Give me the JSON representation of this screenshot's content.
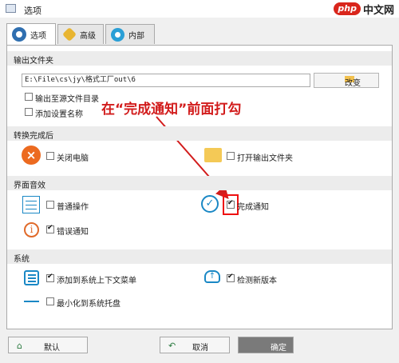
{
  "window": {
    "title": "选项"
  },
  "watermark": {
    "php": "php",
    "text": "中文网"
  },
  "tabs": [
    {
      "label": "选项",
      "icon": "gear-icon"
    },
    {
      "label": "高级",
      "icon": "advanced-icon"
    },
    {
      "label": "内部",
      "icon": "gear-icon"
    }
  ],
  "output_folder": {
    "heading": "输出文件夹",
    "path_value": "E:\\File\\cs\\jy\\格式工厂out\\6",
    "change_label": "改变",
    "options": [
      {
        "label": "输出至源文件目录",
        "checked": false
      },
      {
        "label": "添加设置名称",
        "checked": false
      }
    ]
  },
  "annotation": {
    "text": "在“完成通知”前面打勾",
    "color": "#d21c1c"
  },
  "after_convert": {
    "heading": "转换完成后",
    "shutdown": {
      "label": "关闭电脑",
      "checked": false,
      "icon": "close-circle-icon"
    },
    "open_folder": {
      "label": "打开输出文件夹",
      "checked": false,
      "icon": "folder-icon"
    }
  },
  "ui_sound": {
    "heading": "界面音效",
    "normal_action": {
      "label": "普通操作",
      "checked": false,
      "icon": "sliders-icon"
    },
    "complete_notify": {
      "label": "完成通知",
      "checked": true,
      "icon": "check-circle-icon"
    },
    "error_notify": {
      "label": "错误通知",
      "checked": true,
      "icon": "info-icon"
    }
  },
  "system": {
    "heading": "系统",
    "context_menu": {
      "label": "添加到系统上下文菜单",
      "checked": true,
      "icon": "list-icon"
    },
    "check_update": {
      "label": "检测新版本",
      "checked": true,
      "icon": "cloud-upload-icon"
    },
    "minimize_tray": {
      "label": "最小化到系统托盘",
      "checked": false,
      "icon": "dash-icon"
    }
  },
  "footer": {
    "default_label": "默认",
    "cancel_label": "取消",
    "ok_label": "确定"
  },
  "colors": {
    "accent": "#1a88c5",
    "highlight": "#e11111"
  }
}
